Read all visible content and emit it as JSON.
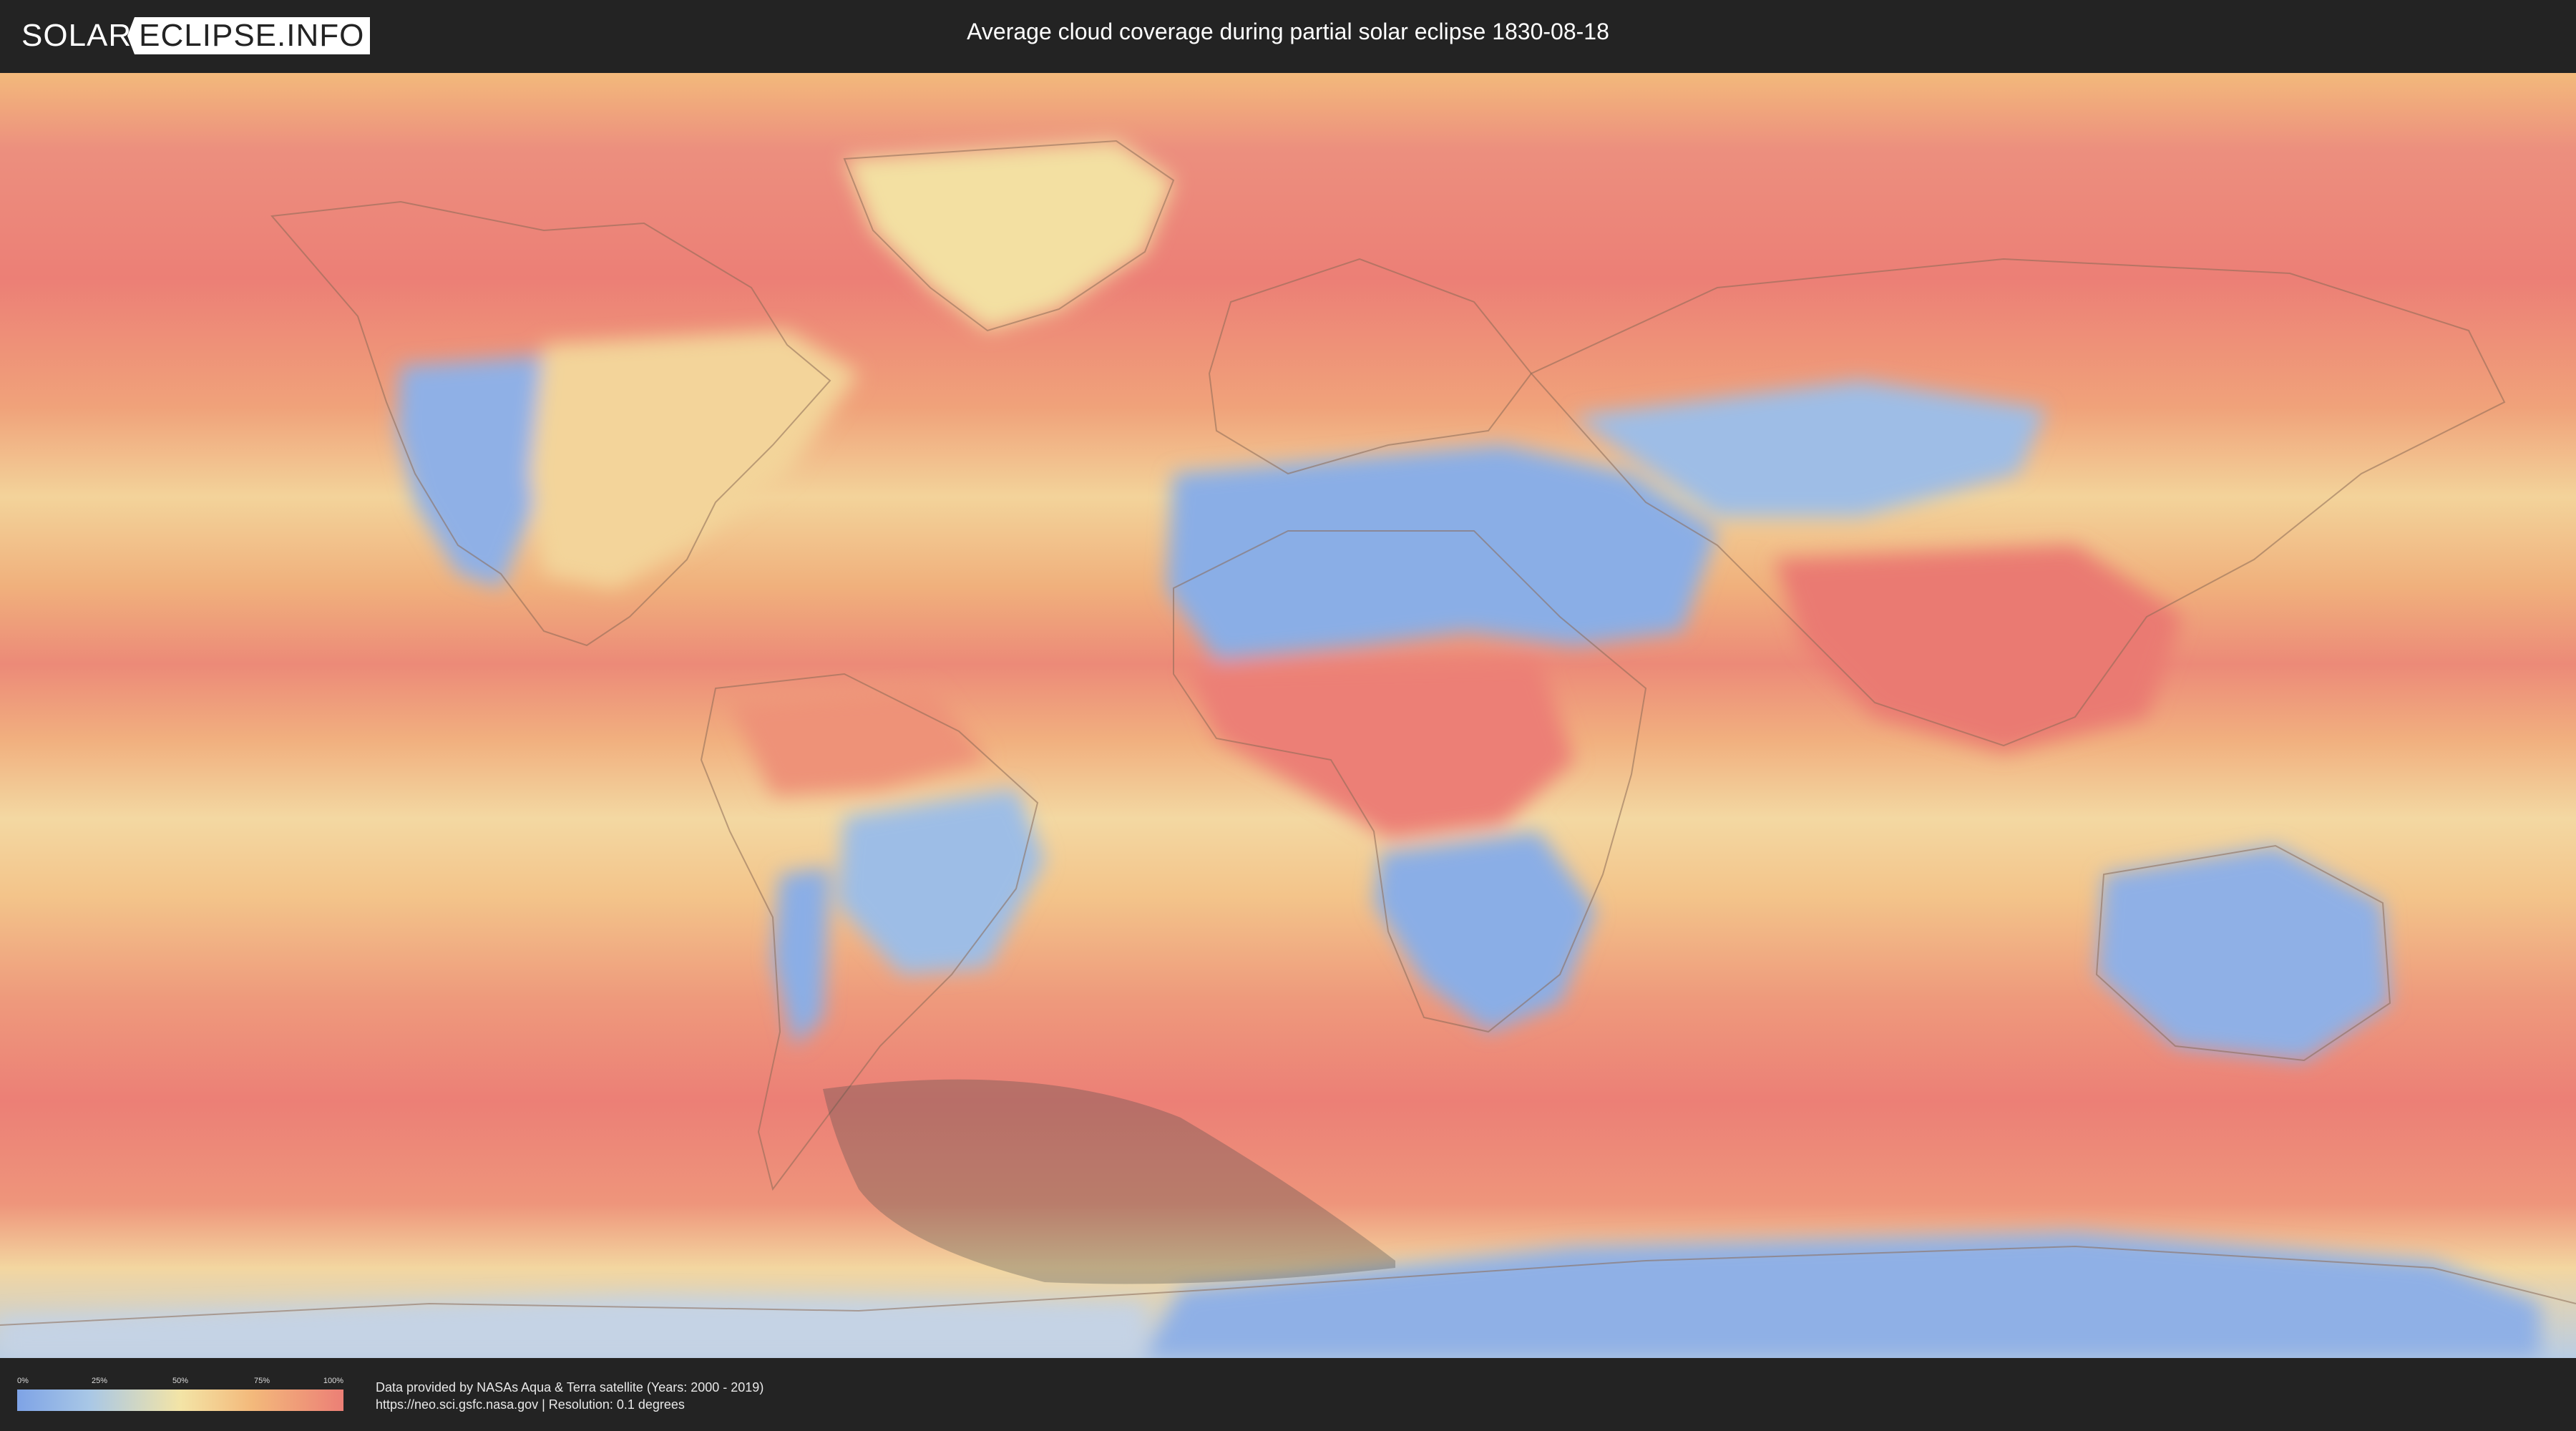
{
  "header": {
    "logo_left": "SOLAR",
    "logo_right": "ECLIPSE.INFO",
    "title": "Average cloud coverage during partial solar eclipse 1830-08-18"
  },
  "map": {
    "projection": "equirectangular",
    "eclipse": "partial solar eclipse 1830-08-18",
    "shading": "partial eclipse visibility zone (southern ocean / Antarctica)",
    "colors": {
      "low": "#7ea3e6",
      "mid_low": "#a8c7e6",
      "mid": "#f3e4a6",
      "mid_high": "#f3b97b",
      "high": "#ec7f76",
      "shadow_overlay": "#4a4a4a"
    }
  },
  "legend": {
    "ticks": [
      "0%",
      "25%",
      "50%",
      "75%",
      "100%"
    ]
  },
  "footer": {
    "credit_line1": "Data provided by NASAs Aqua & Terra satellite (Years: 2000 - 2019)",
    "credit_line2": "https://neo.sci.gsfc.nasa.gov | Resolution: 0.1 degrees"
  }
}
